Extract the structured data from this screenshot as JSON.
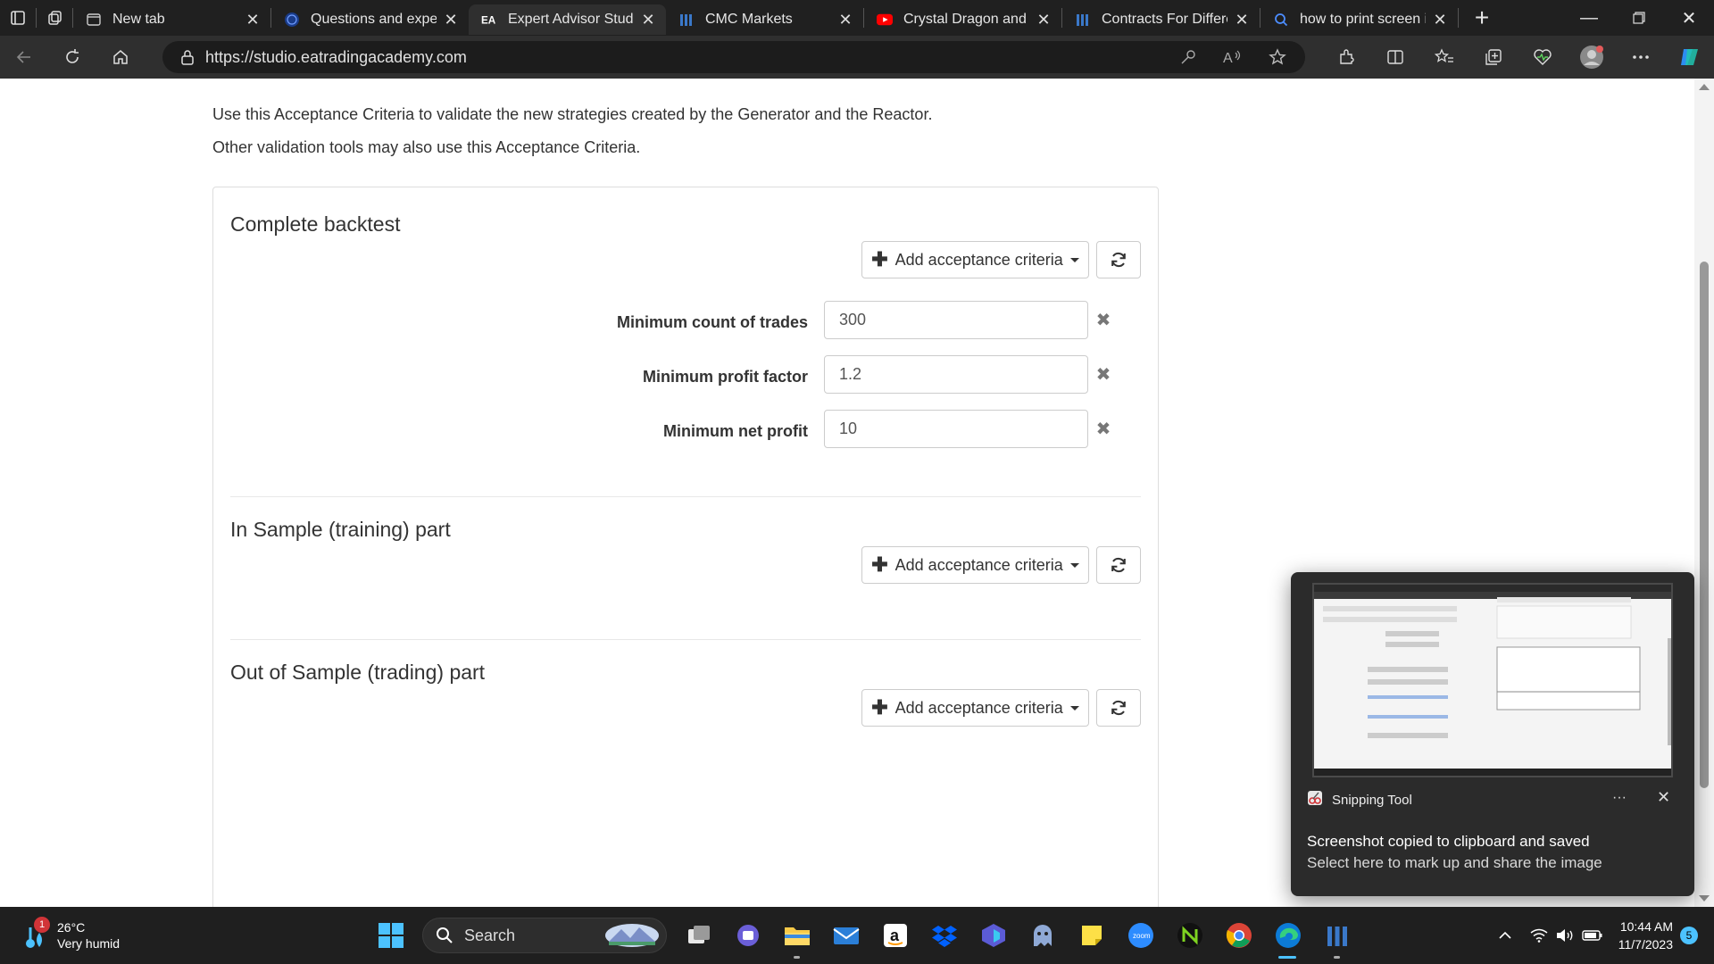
{
  "browser": {
    "tabs": [
      {
        "title": "New tab",
        "icon": "new-tab-icon"
      },
      {
        "title": "Questions and experiences",
        "icon": "globe-icon"
      },
      {
        "title": "Expert Advisor Studio",
        "icon": "ea-logo-icon",
        "favicon_text": "EA",
        "active": true
      },
      {
        "title": "CMC Markets",
        "icon": "cmc-icon"
      },
      {
        "title": "Crystal Dragon and Lotus",
        "icon": "youtube-icon"
      },
      {
        "title": "Contracts For Difference",
        "icon": "cmc-icon"
      },
      {
        "title": "how to print screen in",
        "icon": "search-icon"
      }
    ],
    "url": "https://studio.eatradingacademy.com"
  },
  "page": {
    "intro_line1": "Use this Acceptance Criteria to validate the new strategies created by the Generator and the Reactor.",
    "intro_line2": "Other validation tools may also use this Acceptance Criteria.",
    "add_button_label": "Add acceptance criteria",
    "sections": [
      {
        "title": "Complete backtest",
        "criteria": [
          {
            "label": "Minimum count of trades",
            "value": "300"
          },
          {
            "label": "Minimum profit factor",
            "value": "1.2"
          },
          {
            "label": "Minimum net profit",
            "value": "10"
          }
        ]
      },
      {
        "title": "In Sample (training) part",
        "criteria": []
      },
      {
        "title": "Out of Sample (trading) part",
        "criteria": []
      }
    ]
  },
  "toast": {
    "app_name": "Snipping Tool",
    "title": "Screenshot copied to clipboard and saved",
    "subtitle": "Select here to mark up and share the image"
  },
  "taskbar": {
    "weather_badge": "1",
    "temperature": "26°C",
    "condition": "Very humid",
    "search_label": "Search",
    "time": "10:44 AM",
    "date": "11/7/2023",
    "notification_count": "5"
  },
  "colors": {
    "chrome_dark": "#202020",
    "toolbar": "#2f2f2f",
    "accent": "#4cc2ff",
    "text": "#333333"
  }
}
